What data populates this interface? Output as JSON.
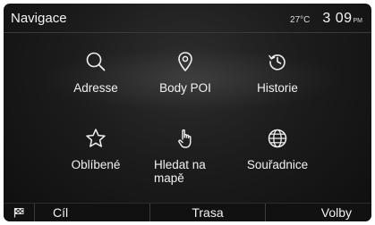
{
  "header": {
    "title": "Navigace",
    "temperature": "27°C",
    "time": "3 09",
    "ampm": "PM"
  },
  "menu": [
    {
      "label": "Adresse",
      "icon": "search-icon"
    },
    {
      "label": "Body POI",
      "icon": "map-pin-icon"
    },
    {
      "label": "Historie",
      "icon": "history-icon"
    },
    {
      "label": "Oblíbené",
      "icon": "star-icon"
    },
    {
      "label": "Hledat na mapě",
      "icon": "hand-pointer-icon"
    },
    {
      "label": "Souřadnice",
      "icon": "globe-icon"
    }
  ],
  "bottom_bar": {
    "flag_icon": "checkered-flag-icon",
    "route_label": "Cíl",
    "trace_label": "Trasa",
    "options_label": "Volby"
  },
  "colors": {
    "background": "#1c1c1c",
    "text": "#f2f2f2",
    "accent_line": "#3a3a3a"
  }
}
